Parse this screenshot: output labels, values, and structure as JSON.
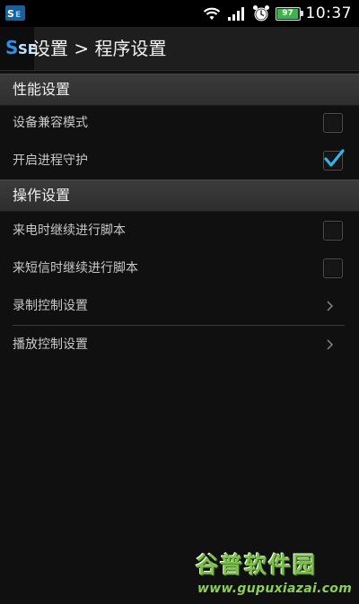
{
  "status_bar": {
    "time": "10:37",
    "battery_level": "97",
    "battery_fraction": 0.97,
    "app_icon": "se-app-icon",
    "icons": [
      "wifi-icon",
      "signal-icon",
      "alarm-clock-icon",
      "battery-icon"
    ]
  },
  "action_bar": {
    "logo_text": "SE",
    "title": "设置 > 程序设置"
  },
  "sections": [
    {
      "header": "性能设置",
      "items": [
        {
          "label": "设备兼容模式",
          "type": "checkbox",
          "checked": false
        },
        {
          "label": "开启进程守护",
          "type": "checkbox",
          "checked": true
        }
      ]
    },
    {
      "header": "操作设置",
      "items": [
        {
          "label": "来电时继续进行脚本",
          "type": "checkbox",
          "checked": false
        },
        {
          "label": "来短信时继续进行脚本",
          "type": "checkbox",
          "checked": false
        },
        {
          "label": "录制控制设置",
          "type": "link",
          "icon": "chevron-right-icon"
        },
        {
          "label": "播放控制设置",
          "type": "link",
          "icon": "chevron-right-icon"
        }
      ]
    }
  ],
  "watermark": {
    "title": "谷普软件园",
    "url": "www.gupuxiazai.com"
  },
  "colors": {
    "accent_check": "#33b5e5",
    "section_header_bg": "#353535",
    "background": "#101010",
    "watermark_green": "#7cc04b"
  }
}
